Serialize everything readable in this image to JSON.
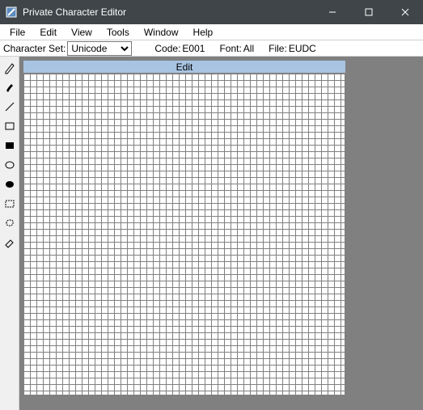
{
  "window": {
    "title": "Private Character Editor"
  },
  "menu": {
    "items": [
      "File",
      "Edit",
      "View",
      "Tools",
      "Window",
      "Help"
    ]
  },
  "infobar": {
    "charset_label": "Character Set:",
    "charset_value": "Unicode",
    "code_label": "Code:",
    "code_value": "E001",
    "font_label": "Font:",
    "font_value": "All",
    "file_label": "File:",
    "file_value": "EUDC"
  },
  "tools": [
    {
      "name": "pencil-icon"
    },
    {
      "name": "brush-icon"
    },
    {
      "name": "line-icon"
    },
    {
      "name": "rect-outline-icon"
    },
    {
      "name": "rect-filled-icon"
    },
    {
      "name": "ellipse-outline-icon"
    },
    {
      "name": "ellipse-filled-icon"
    },
    {
      "name": "rect-select-icon"
    },
    {
      "name": "free-select-icon"
    },
    {
      "name": "eraser-icon"
    }
  ],
  "canvas": {
    "title": "Edit",
    "grid_cols": 50,
    "grid_rows": 50
  }
}
